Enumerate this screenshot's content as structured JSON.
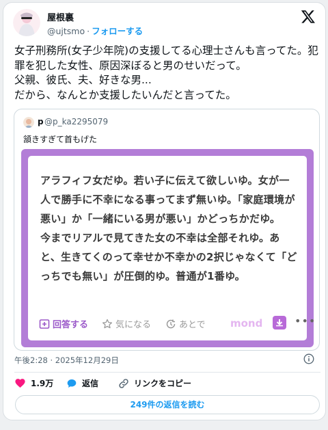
{
  "author": {
    "name": "屋根裏",
    "handle": "@ujtsmo",
    "separator": "·",
    "follow_label": "フォローする"
  },
  "tweet": {
    "text": "女子刑務所(女子少年院)の支援してる心理士さんも言ってた。犯罪を犯した女性、原因深ぼると男のせいだって。\n父親、彼氏、夫、好きな男...\nだから、なんとか支援したいんだと言ってた。"
  },
  "quote": {
    "name": "p",
    "handle": "@p_ka2295079",
    "text": "頷きすぎて首もげた",
    "image": {
      "body": "アラフィフ女だゆ。若い子に伝えて欲しいゆ。女が一人で勝手に不幸になる事ってまず無いゆ。「家庭環境が悪い」か「一緒にいる男が悪い」かどっちかだゆ。\n今までリアルで見てきた女の不幸は全部それゆ。あと、生きてくのって幸せか不幸かの2択じゃなくて「どっちでも無い」が圧倒的ゆ。普通が1番ゆ。",
      "reply_label": "回答する",
      "favorite_label": "気になる",
      "later_label": "あとで",
      "logo_text": "mond",
      "more_label": "•••",
      "accent_color": "#b37dd7"
    }
  },
  "meta": {
    "timestamp": "午後2:28 · 2025年12月29日"
  },
  "actions": {
    "like_count": "1.9万",
    "reply_label": "返信",
    "copy_link_label": "リンクをコピー"
  },
  "replies_button": "249件の返信を読む",
  "colors": {
    "link": "#1d9bf0",
    "like": "#f91880"
  }
}
